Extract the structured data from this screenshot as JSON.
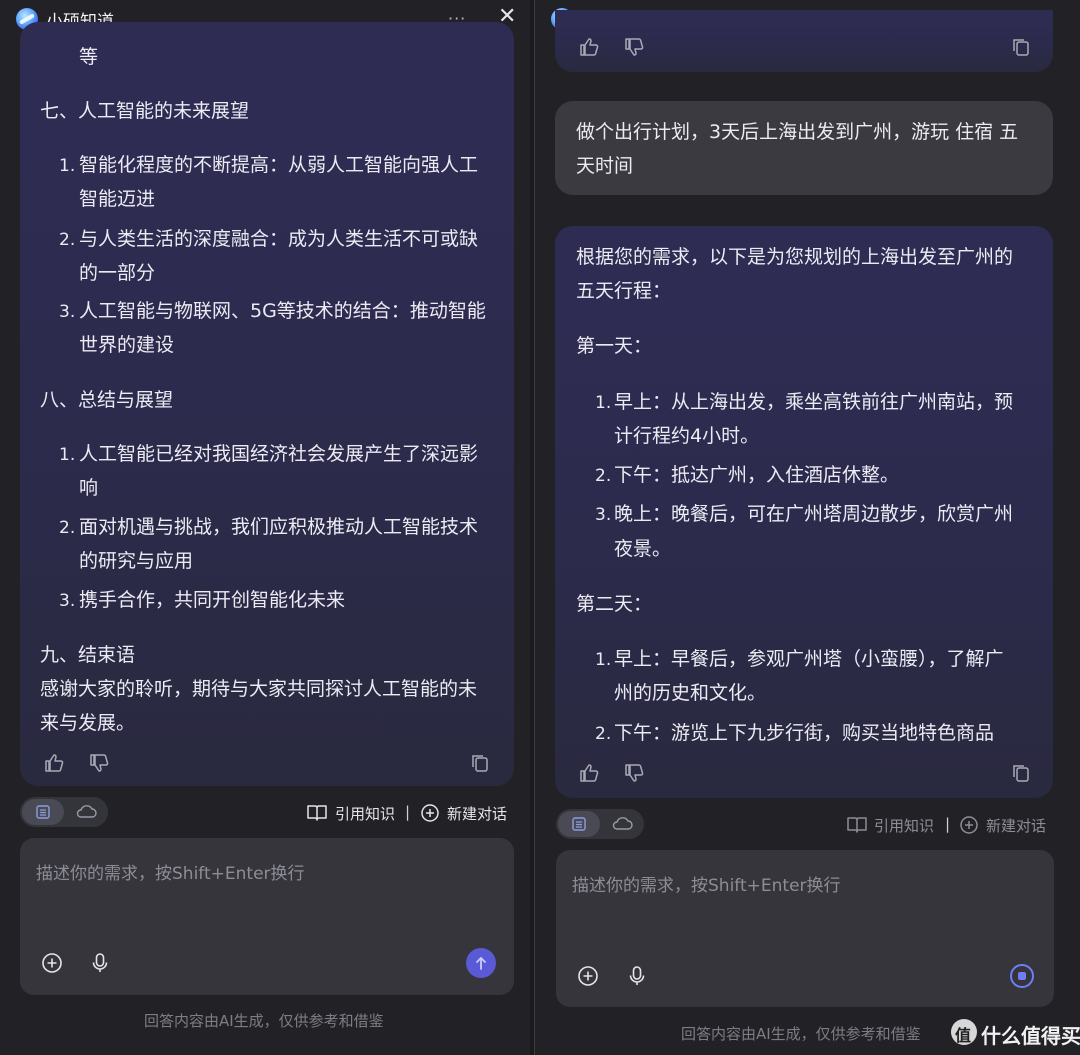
{
  "app": {
    "title": "小硕知道",
    "more": "···"
  },
  "left": {
    "lines": [
      "等",
      "七、人工智能的未来展望",
      "智能化程度的不断提高：从弱人工智能向强人工",
      "智能迈进",
      "与人类生活的深度融合：成为人类生活不可或缺",
      "的一部分",
      "人工智能与物联网、5G等技术的结合：推动智能",
      "世界的建设",
      "八、总结与展望",
      "人工智能已经对我国经济社会发展产生了深远影",
      "响",
      "面对机遇与挑战，我们应积极推动人工智能技术",
      "的研究与应用",
      "携手合作，共同开创智能化未来",
      "九、结束语",
      "感谢大家的聆听，期待与大家共同探讨人工智能的未",
      "来与发展。"
    ],
    "nums": [
      "1.",
      "2.",
      "3.",
      "1.",
      "2.",
      "3."
    ]
  },
  "right": {
    "user_lines": [
      "做个出行计划，3天后上海出发到广州，游玩 住宿 五",
      "天时间"
    ],
    "lines": [
      "根据您的需求，以下是为您规划的上海出发至广州的",
      "五天行程：",
      "第一天：",
      "早上：从上海出发，乘坐高铁前往广州南站，预",
      "计行程约4小时。",
      "下午：抵达广州，入住酒店休整。",
      "晚上：晚餐后，可在广州塔周边散步，欣赏广州",
      "夜景。",
      "第二天：",
      "早上：早餐后，参观广州塔（小蛮腰），了解广",
      "州的历史和文化。",
      "下午：游览上下九步行街，购买当地特色商品"
    ],
    "nums": [
      "1.",
      "2.",
      "3.",
      "1.",
      "2."
    ]
  },
  "toolbar": {
    "cite_label": "引用知识",
    "separator": "|",
    "new_chat_label": "新建对话"
  },
  "input": {
    "placeholder": "描述你的需求，按Shift+Enter换行"
  },
  "footer": {
    "note": "回答内容由AI生成，仅供参考和借鉴"
  },
  "watermark": {
    "logo_char": "值",
    "text": "什么值得买"
  },
  "icons": {
    "like": "thumbs-up-icon",
    "dislike": "thumbs-down-icon",
    "copy": "copy-icon",
    "list": "list-icon",
    "cloud": "cloud-icon",
    "book": "book-icon",
    "add": "plus-circle-icon",
    "mic": "microphone-icon",
    "send": "send-arrow-icon",
    "stop": "stop-icon",
    "close": "close-icon"
  },
  "colors": {
    "accent": "#5a5ad6",
    "bubble_ai": "#2f2c54",
    "panel_bg": "#222226"
  }
}
